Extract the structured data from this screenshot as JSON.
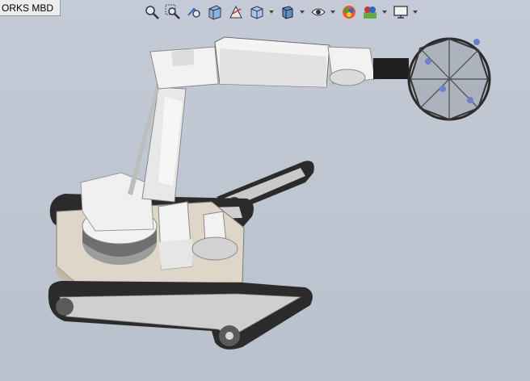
{
  "tab": {
    "label": "ORKS MBD"
  },
  "toolbar": {
    "tools": [
      {
        "name": "zoom-to-fit-icon"
      },
      {
        "name": "zoom-to-area-icon"
      },
      {
        "name": "previous-view-icon"
      },
      {
        "name": "section-view-icon"
      },
      {
        "name": "dynamic-annotation-icon"
      },
      {
        "name": "view-orientation-icon",
        "dropdown": true
      },
      {
        "name": "display-style-icon",
        "dropdown": true
      },
      {
        "name": "hide-show-items-icon",
        "dropdown": true
      },
      {
        "name": "edit-appearance-icon"
      },
      {
        "name": "apply-scene-icon",
        "dropdown": true
      },
      {
        "name": "view-settings-icon",
        "dropdown": true
      }
    ]
  },
  "colors": {
    "background": "#c0c7d2",
    "part_white": "#f2f2f2",
    "part_shade": "#9c9c9c",
    "track_dark": "#2b2b2b",
    "plate": "#ded6c8"
  }
}
